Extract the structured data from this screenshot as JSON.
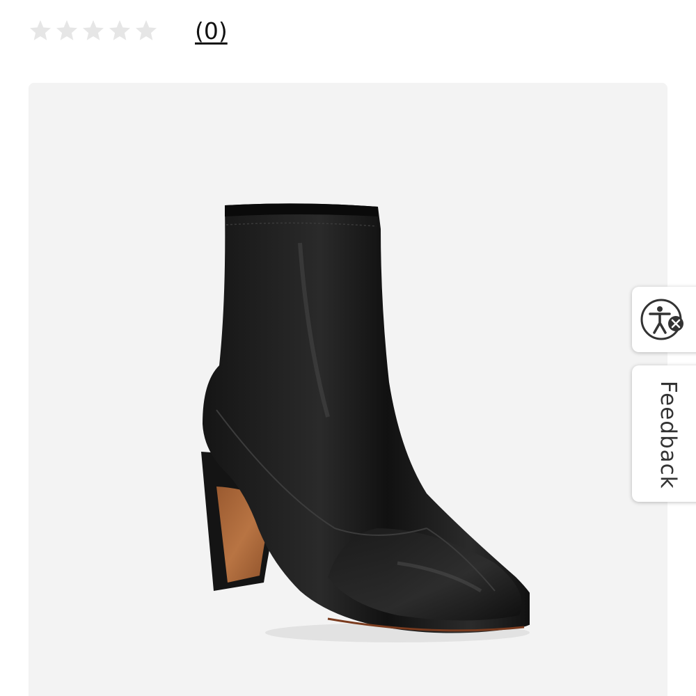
{
  "rating": {
    "stars_filled": 0,
    "stars_total": 5,
    "review_count_label": "(0)",
    "star_color": "#e6e6e6"
  },
  "product_image": {
    "background_color": "#f3f3f3"
  },
  "accessibility_widget": {
    "icon": "accessibility-icon",
    "badge_icon": "close-icon"
  },
  "feedback_tab": {
    "label": "Feedback"
  }
}
